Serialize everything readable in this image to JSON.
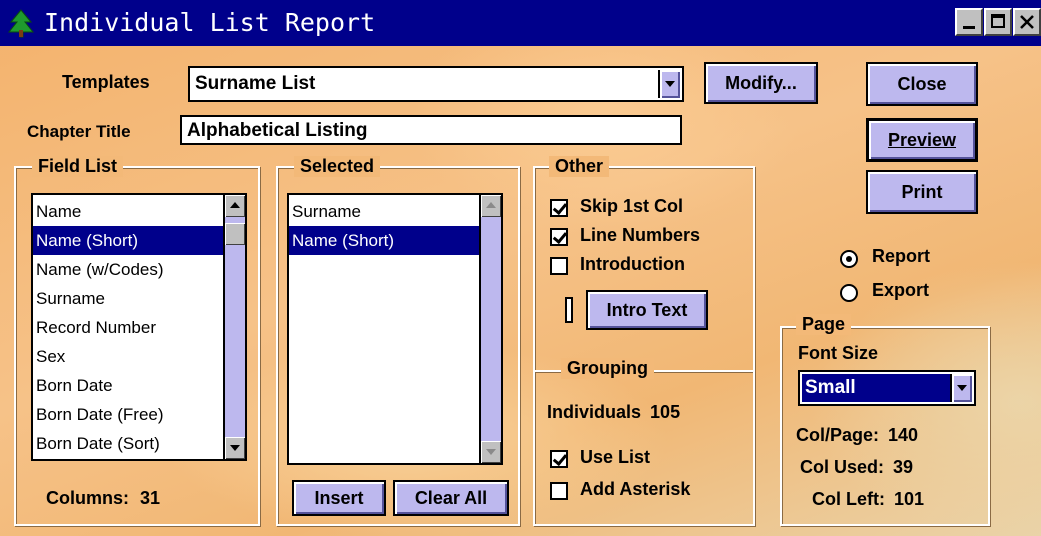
{
  "window": {
    "title": "Individual List Report"
  },
  "templates": {
    "label": "Templates",
    "value": "Surname List"
  },
  "chapter_title": {
    "label": "Chapter Title",
    "value": "Alphabetical Listing"
  },
  "buttons": {
    "modify": "Modify...",
    "close": "Close",
    "preview": "Preview",
    "print": "Print",
    "intro_text": "Intro Text",
    "insert": "Insert",
    "clear_all": "Clear All"
  },
  "field_list": {
    "title": "Field List",
    "items": [
      "Name",
      "Name (Short)",
      "Name (w/Codes)",
      "Surname",
      "Record Number",
      "Sex",
      "Born Date",
      "Born Date (Free)",
      "Born Date (Sort)"
    ],
    "selected_index": 1,
    "columns_label": "Columns:",
    "columns_value": "31"
  },
  "selected_list": {
    "title": "Selected",
    "items": [
      "Surname",
      "Name (Short)"
    ],
    "selected_index": 1
  },
  "other": {
    "title": "Other",
    "skip_first_col": {
      "label": "Skip 1st Col",
      "checked": true
    },
    "line_numbers": {
      "label": "Line Numbers",
      "checked": true
    },
    "introduction": {
      "label": "Introduction",
      "checked": false
    }
  },
  "grouping": {
    "title": "Grouping",
    "individuals_label": "Individuals",
    "individuals_value": "105",
    "use_list": {
      "label": "Use List",
      "checked": true
    },
    "add_asterisk": {
      "label": "Add Asterisk",
      "checked": false
    }
  },
  "output": {
    "report": {
      "label": "Report",
      "selected": true
    },
    "export": {
      "label": "Export",
      "selected": false
    }
  },
  "page": {
    "title": "Page",
    "font_size_label": "Font Size",
    "font_size_value": "Small",
    "col_page_label": "Col/Page:",
    "col_page_value": "140",
    "col_used_label": "Col Used:",
    "col_used_value": "39",
    "col_left_label": "Col Left:",
    "col_left_value": "101"
  },
  "colors": {
    "titlebar": "#00008b",
    "selection": "#00008b",
    "button_face": "#bdb8ee"
  }
}
